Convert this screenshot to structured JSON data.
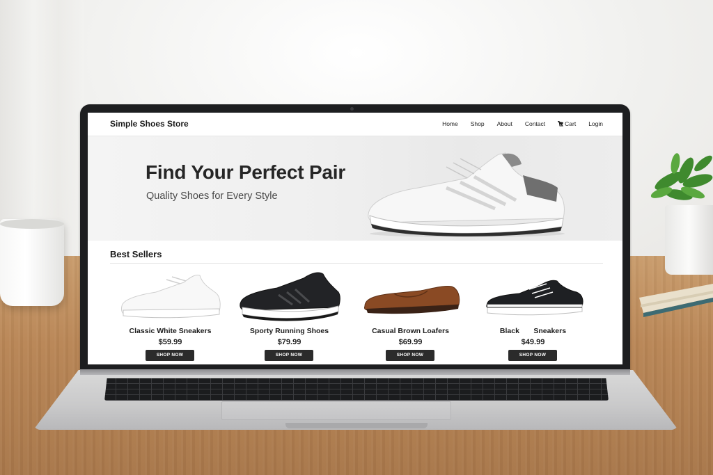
{
  "nav": {
    "brand": "Simple Shoes Store",
    "items": [
      {
        "label": "Home"
      },
      {
        "label": "Shop"
      },
      {
        "label": "About"
      },
      {
        "label": "Contact"
      },
      {
        "label": "Cart",
        "icon": "cart-icon"
      },
      {
        "label": "Login"
      }
    ]
  },
  "hero": {
    "title": "Find Your Perfect Pair",
    "subtitle": "Quality Shoes for Every Style"
  },
  "best_sellers": {
    "title": "Best Sellers",
    "products": [
      {
        "name": "Classic White Sneakers",
        "price": "$59.99",
        "button": "SHOP NOW"
      },
      {
        "name": "Sporty Running Shoes",
        "price": "$79.99",
        "button": "SHOP NOW"
      },
      {
        "name": "Casual Brown Loafers",
        "price": "$69.99",
        "button": "SHOP NOW"
      },
      {
        "name": "Black       Sneakers",
        "price": "$49.99",
        "button": "SHOP NOW"
      }
    ]
  },
  "colors": {
    "button_bg": "#2b2b2b",
    "loafer_brown": "#8a4a24"
  }
}
